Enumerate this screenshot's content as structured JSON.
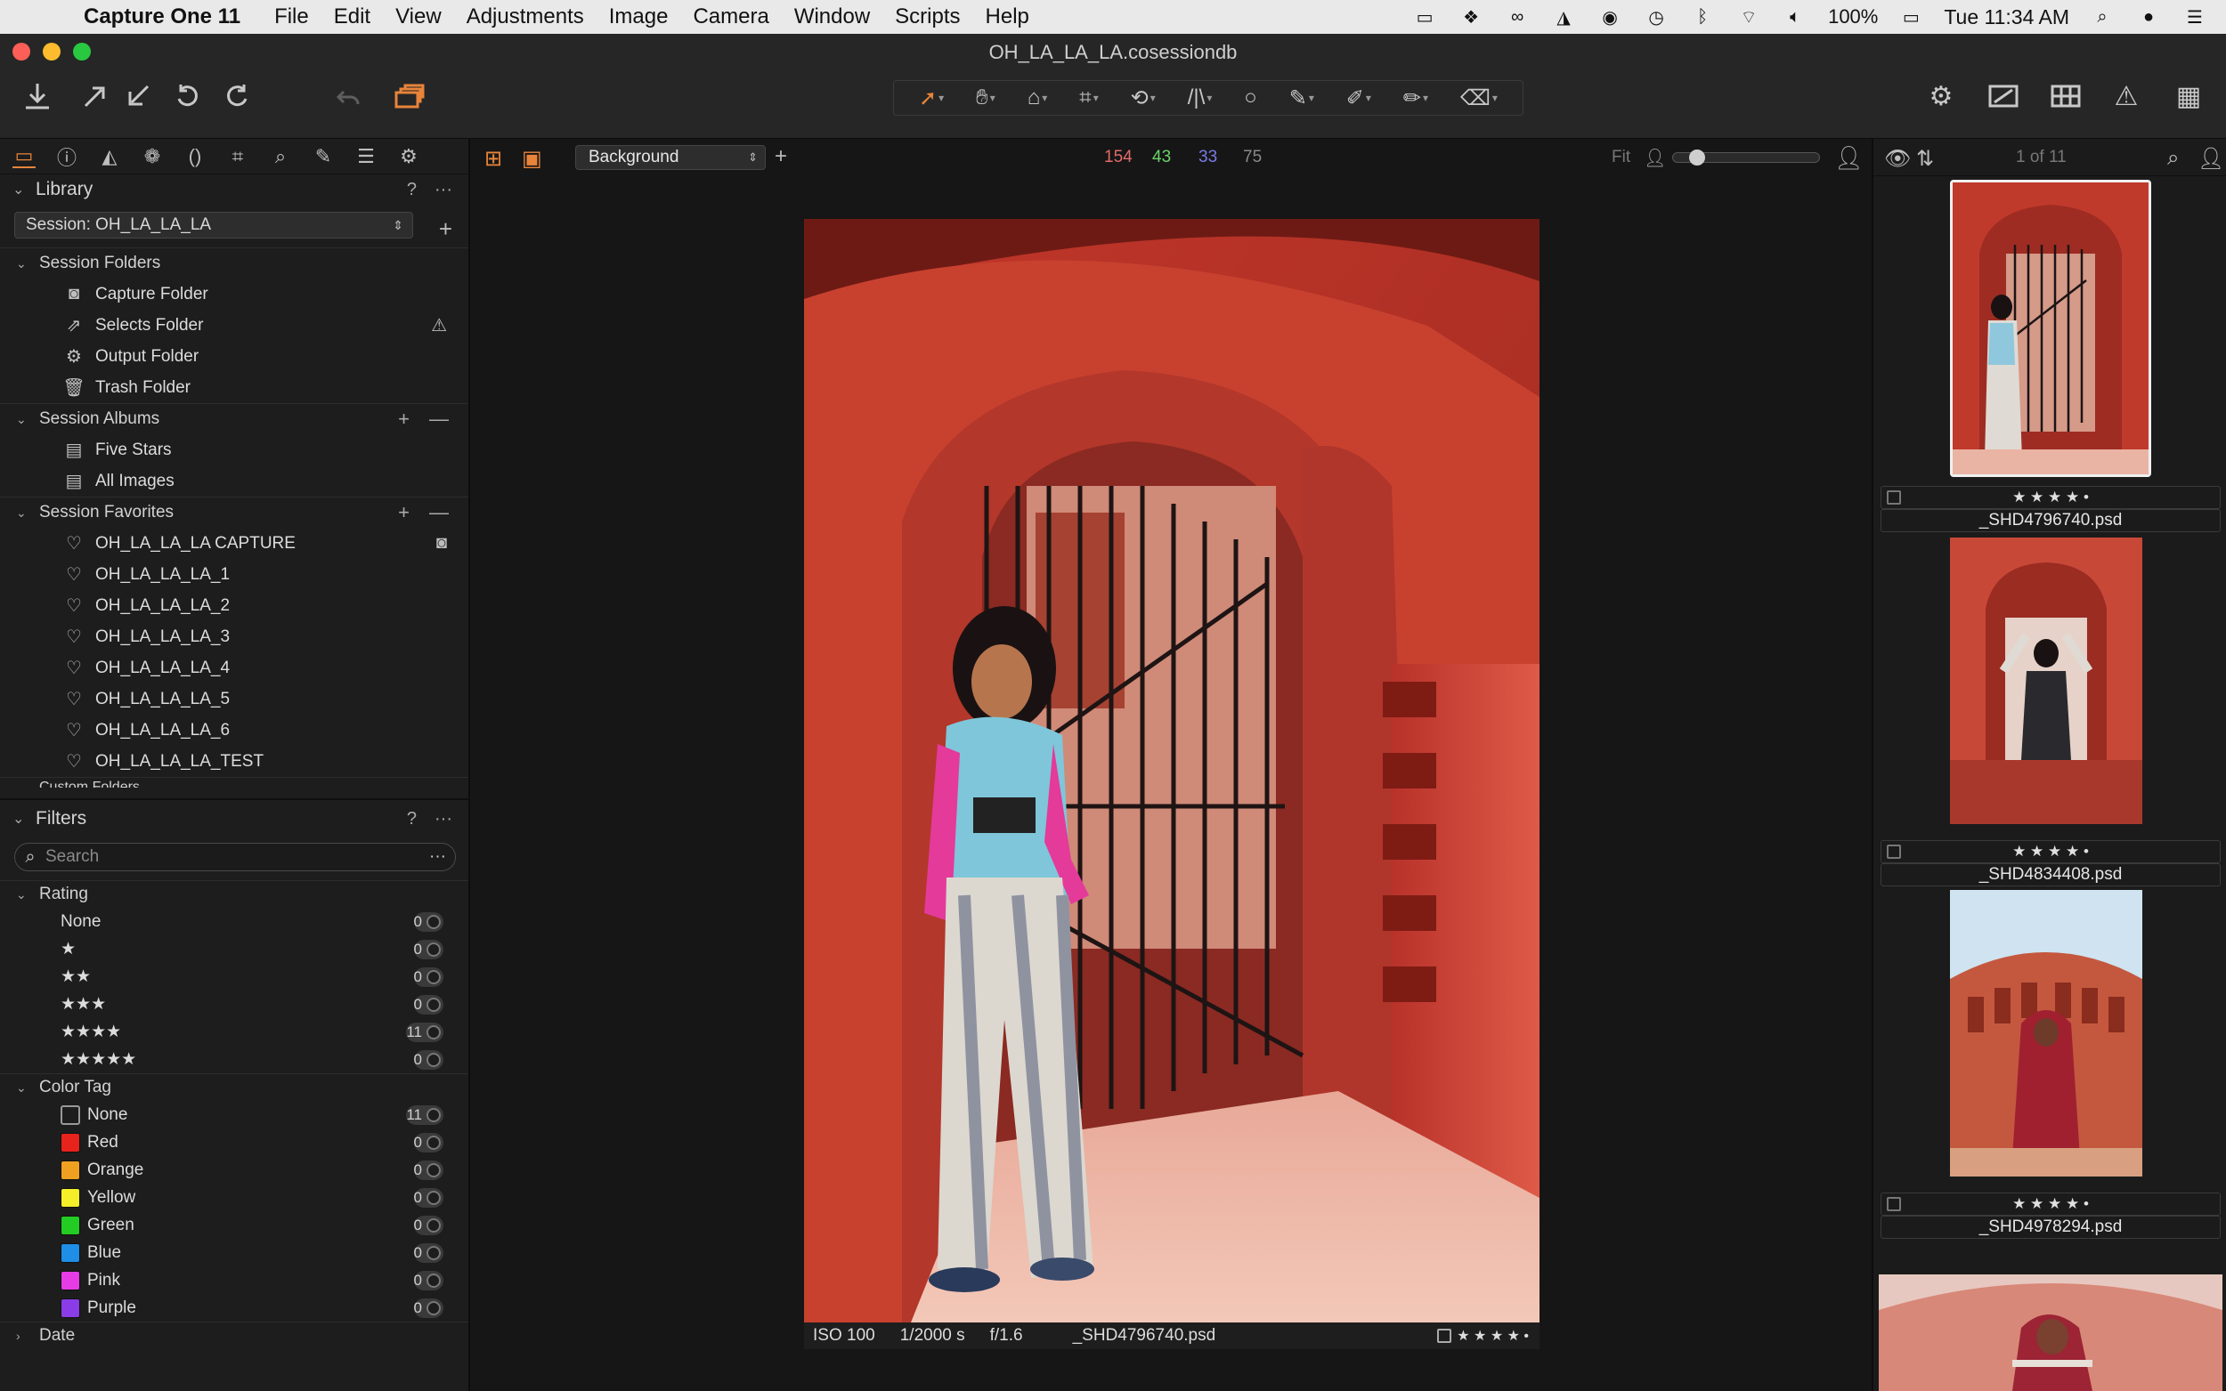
{
  "menubar": {
    "app_name": "Capture One 11",
    "menus": [
      "File",
      "Edit",
      "View",
      "Adjustments",
      "Image",
      "Camera",
      "Window",
      "Scripts",
      "Help"
    ],
    "battery": "100%",
    "clock": "Tue 11:34 AM",
    "status_icons": [
      "screen-icon",
      "dropbox-icon",
      "creative-cloud-icon",
      "app-icon",
      "app2-icon",
      "time-machine-icon",
      "bluetooth-icon",
      "wifi-icon",
      "volume-icon",
      "battery-icon",
      "spotlight-icon",
      "siri-icon",
      "notification-icon"
    ]
  },
  "window": {
    "title": "OH_LA_LA_LA.cosessiondb"
  },
  "library": {
    "title": "Library",
    "session_select": "Session: OH_LA_LA_LA",
    "session_folders": {
      "title": "Session Folders",
      "items": [
        {
          "label": "Capture Folder",
          "icon": "capture-folder-icon"
        },
        {
          "label": "Selects Folder",
          "icon": "selects-folder-icon"
        },
        {
          "label": "Output Folder",
          "icon": "output-folder-icon"
        },
        {
          "label": "Trash Folder",
          "icon": "trash-folder-icon"
        }
      ]
    },
    "session_albums": {
      "title": "Session Albums",
      "items": [
        {
          "label": "Five Stars",
          "icon": "smart-album-icon"
        },
        {
          "label": "All Images",
          "icon": "smart-album-icon"
        }
      ]
    },
    "session_favorites": {
      "title": "Session Favorites",
      "items": [
        "OH_LA_LA_LA CAPTURE",
        "OH_LA_LA_LA_1",
        "OH_LA_LA_LA_2",
        "OH_LA_LA_LA_3",
        "OH_LA_LA_LA_4",
        "OH_LA_LA_LA_5",
        "OH_LA_LA_LA_6",
        "OH_LA_LA_LA_TEST"
      ]
    },
    "custom_folders_partial": "Custom Folders"
  },
  "filters": {
    "title": "Filters",
    "search_placeholder": "Search",
    "rating": {
      "title": "Rating",
      "rows": [
        {
          "label": "None",
          "count": "0"
        },
        {
          "label": "★",
          "count": "0"
        },
        {
          "label": "★★",
          "count": "0"
        },
        {
          "label": "★★★",
          "count": "0"
        },
        {
          "label": "★★★★",
          "count": "11"
        },
        {
          "label": "★★★★★",
          "count": "0"
        }
      ]
    },
    "color_tag": {
      "title": "Color Tag",
      "rows": [
        {
          "label": "None",
          "count": "11",
          "color": "none"
        },
        {
          "label": "Red",
          "count": "0",
          "color": "#e8231c"
        },
        {
          "label": "Orange",
          "count": "0",
          "color": "#f0a020"
        },
        {
          "label": "Yellow",
          "count": "0",
          "color": "#f5ee28"
        },
        {
          "label": "Green",
          "count": "0",
          "color": "#22cc22"
        },
        {
          "label": "Blue",
          "count": "0",
          "color": "#1e8ee6"
        },
        {
          "label": "Pink",
          "count": "0",
          "color": "#e63ce6"
        },
        {
          "label": "Purple",
          "count": "0",
          "color": "#8a3ce6"
        }
      ]
    },
    "date_title": "Date"
  },
  "viewer": {
    "layer_select": "Background",
    "cursor_values": {
      "r": "154",
      "g": "43",
      "b": "33",
      "l": "75"
    },
    "colors": {
      "r": "#e26a6a",
      "g": "#6ad46a",
      "b": "#7a7ae6",
      "l": "#8a8a8a"
    },
    "fit_label": "Fit",
    "zoom_level": 0.12,
    "caption": {
      "iso": "ISO 100",
      "shutter": "1/2000 s",
      "aperture": "f/1.6",
      "filename": "_SHD4796740.psd",
      "stars": "★ ★ ★ ★ •"
    }
  },
  "browser": {
    "count": "1 of 11",
    "thumbnails": [
      {
        "name": "_SHD4796740.psd",
        "stars": "★ ★ ★ ★ •",
        "selected": true
      },
      {
        "name": "_SHD4834408.psd",
        "stars": "★ ★ ★ ★ •",
        "selected": false
      },
      {
        "name": "_SHD4978294.psd",
        "stars": "★ ★ ★ ★ •",
        "selected": false
      }
    ]
  },
  "accent_color": "#e8843a"
}
